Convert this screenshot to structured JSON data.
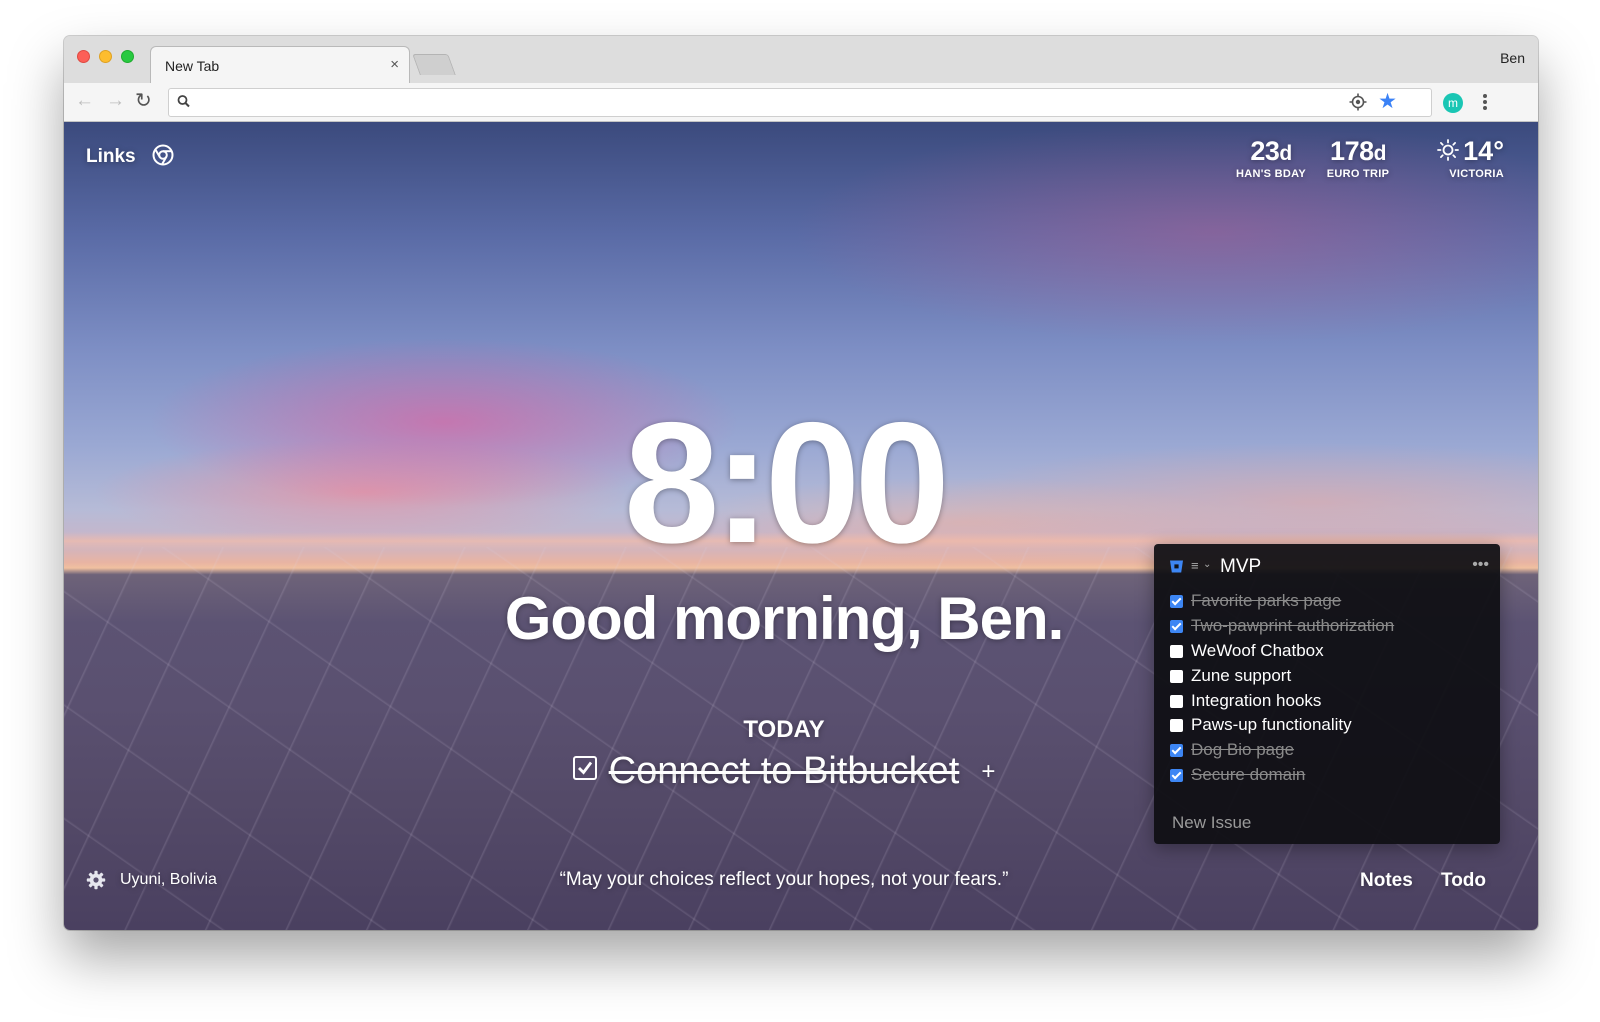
{
  "browser": {
    "tab_title": "New Tab",
    "tab_close": "×",
    "profile_name": "Ben",
    "omnibox_value": "",
    "extension_letter": "m"
  },
  "dashboard": {
    "links_label": "Links",
    "countdowns": [
      {
        "value": "23",
        "unit": "d",
        "label": "HAN'S BDAY"
      },
      {
        "value": "178",
        "unit": "d",
        "label": "EURO TRIP"
      }
    ],
    "weather": {
      "temp": "14°",
      "location": "VICTORIA"
    },
    "clock": "8:00",
    "greeting": "Good morning, Ben.",
    "focus_label": "TODAY",
    "focus_text": "Connect to Bitbucket",
    "focus_add": "+",
    "location": "Uyuni, Bolivia",
    "quote": "“May your choices reflect your hopes, not your fears.”",
    "notes_label": "Notes",
    "todo_label": "Todo"
  },
  "todo_panel": {
    "title": "MVP",
    "more": "•••",
    "items": [
      {
        "text": "Favorite parks page",
        "done": true
      },
      {
        "text": "Two-pawprint authorization",
        "done": true
      },
      {
        "text": "WeWoof Chatbox",
        "done": false
      },
      {
        "text": "Zune support",
        "done": false
      },
      {
        "text": "Integration hooks",
        "done": false
      },
      {
        "text": "Paws-up functionality",
        "done": false
      },
      {
        "text": "Dog Bio page",
        "done": true
      },
      {
        "text": "Secure domain",
        "done": true
      }
    ],
    "new_issue_placeholder": "New Issue"
  },
  "colors": {
    "accent_blue": "#3d86f4",
    "extension_teal": "#1ac6b4"
  }
}
